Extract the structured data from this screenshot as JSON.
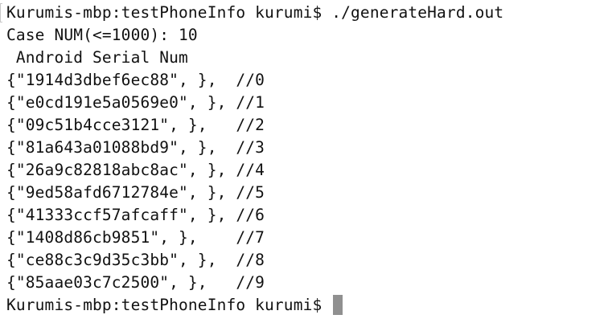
{
  "terminal": {
    "prompt_command": "Kurumis-mbp:testPhoneInfo kurumi$ ./generateHard.out",
    "case_prompt": "Case NUM(<=1000): 10",
    "header": " Android Serial Num",
    "rows": [
      "{\"1914d3dbef6ec88\", },  //0",
      "{\"e0cd191e5a0569e0\", }, //1",
      "{\"09c51b4cce3121\", },   //2",
      "{\"81a643a01088bd9\", },  //3",
      "{\"26a9c82818abc8ac\", }, //4",
      "{\"9ed58afd6712784e\", }, //5",
      "{\"41333ccf57afcaff\", }, //6",
      "{\"1408d86cb9851\", },    //7",
      "{\"ce88c3c9d35c3bb\", },  //8",
      "{\"85aae03c7c2500\", },   //9"
    ],
    "final_prompt": "Kurumis-mbp:testPhoneInfo kurumi$ "
  }
}
